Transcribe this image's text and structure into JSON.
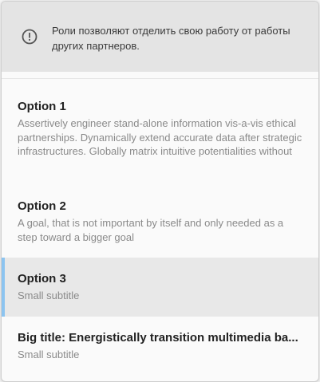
{
  "banner": {
    "icon": "info-circle-icon",
    "text": "Роли позволяют отделить свою работу от работы других партнеров."
  },
  "options": [
    {
      "title": "Option 1",
      "subtitle": "Assertively engineer stand-alone information vis-a-vis ethical partnerships. Dynamically extend accurate data after strategic infrastructures. Globally matrix intuitive potentialities without"
    },
    {
      "title": "Option 2",
      "subtitle": "A goal, that is not important by itself and only needed as a step toward a bigger goal"
    },
    {
      "title": "Option 3",
      "subtitle": "Small subtitle",
      "selected": true
    },
    {
      "title": "Big title: Energistically transition multimedia ba...",
      "subtitle": "Small subtitle"
    }
  ],
  "colors": {
    "accent": "#8cc4f0",
    "banner_bg": "#e4e4e4",
    "selected_bg": "#e8e8e8"
  }
}
